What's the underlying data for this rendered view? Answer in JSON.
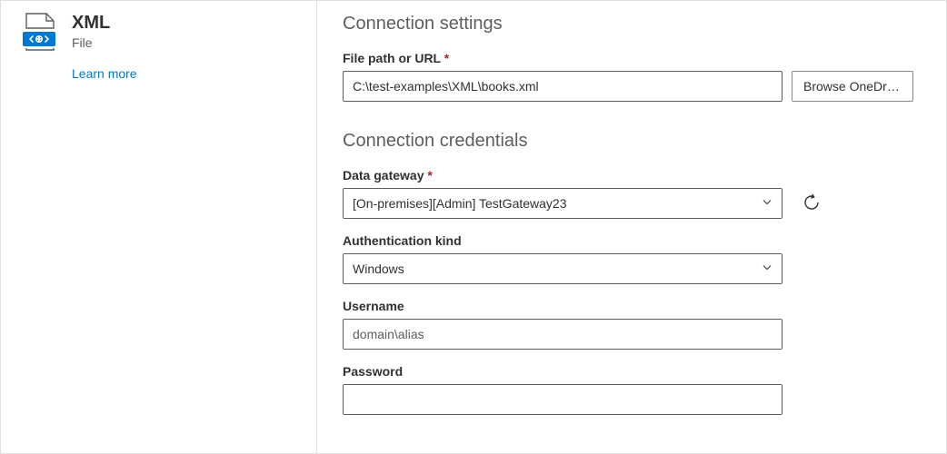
{
  "sidebar": {
    "title": "XML",
    "subtitle": "File",
    "learn_more": "Learn more"
  },
  "settings": {
    "heading": "Connection settings",
    "file_path_label": "File path or URL",
    "file_path_value": "C:\\test-examples\\XML\\books.xml",
    "browse_label": "Browse OneDrive..."
  },
  "credentials": {
    "heading": "Connection credentials",
    "gateway_label": "Data gateway",
    "gateway_value": "[On-premises][Admin] TestGateway23",
    "auth_label": "Authentication kind",
    "auth_value": "Windows",
    "username_label": "Username",
    "username_placeholder": "domain\\alias",
    "password_label": "Password"
  },
  "glyphs": {
    "required": "*"
  }
}
